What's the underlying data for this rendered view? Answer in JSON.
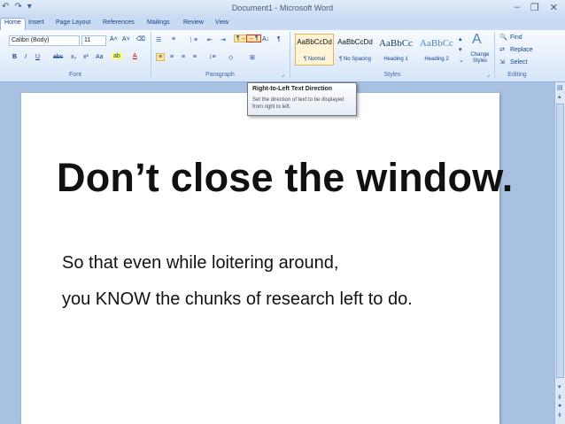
{
  "window": {
    "title": "Document1 - Microsoft Word",
    "minimize_icon": "minimize-icon",
    "maximize_icon": "restore-icon"
  },
  "tabs": [
    "Home",
    "Insert",
    "Page Layout",
    "References",
    "Mailings",
    "Review",
    "View"
  ],
  "font_group": {
    "font_name": "Calibri (Body)",
    "font_size": "11",
    "label": "Font"
  },
  "paragraph_group": {
    "label": "Paragraph"
  },
  "styles_group": {
    "label": "Styles",
    "styles": [
      {
        "sample": "AaBbCcDd",
        "name": "¶ Normal"
      },
      {
        "sample": "AaBbCcDd",
        "name": "¶ No Spacing"
      },
      {
        "sample": "AaBbCc",
        "name": "Heading 1"
      },
      {
        "sample": "AaBbCc",
        "name": "Heading 2"
      }
    ],
    "change_styles": "Change Styles"
  },
  "editing_group": {
    "label": "Editing",
    "find": "Find",
    "replace": "Replace",
    "select": "Select"
  },
  "tooltip": {
    "title": "Right-to-Left Text Direction",
    "description": "Set the direction of text to be displayed from right to left."
  },
  "document": {
    "headline": "Don’t close the window.",
    "lines": [
      "So that even while loitering around,",
      "you KNOW the chunks of research left to do."
    ]
  },
  "colors": {
    "ribbon": "#dfe9f5",
    "workspace": "#a9c1e0",
    "highlight": "#fff5d6"
  }
}
